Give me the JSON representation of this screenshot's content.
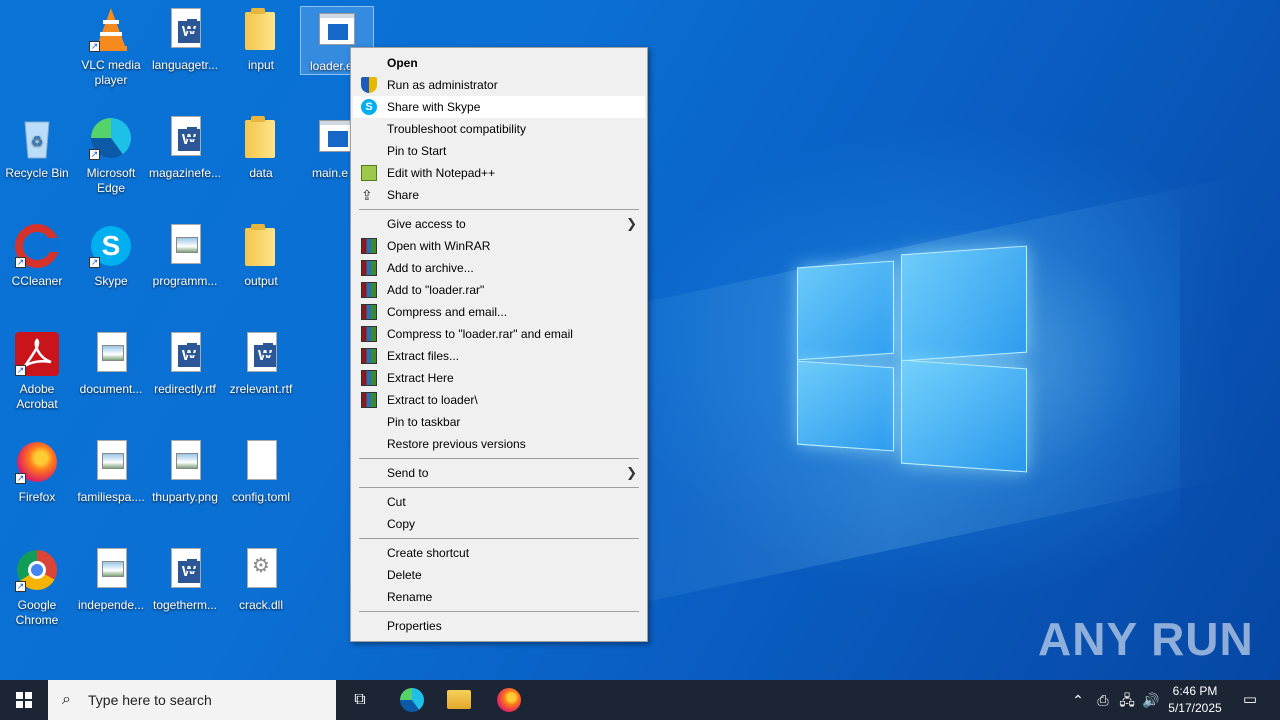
{
  "desktop": {
    "icons": [
      {
        "label": "VLC media player"
      },
      {
        "label": "languagetr..."
      },
      {
        "label": "input"
      },
      {
        "label": "loader.e"
      },
      {
        "label": "Recycle Bin"
      },
      {
        "label": "Microsoft Edge"
      },
      {
        "label": "magazinefe..."
      },
      {
        "label": "data"
      },
      {
        "label": "main.e"
      },
      {
        "label": "CCleaner"
      },
      {
        "label": "Skype"
      },
      {
        "label": "programm..."
      },
      {
        "label": "output"
      },
      {
        "label": "Adobe Acrobat"
      },
      {
        "label": "document..."
      },
      {
        "label": "redirectly.rtf"
      },
      {
        "label": "zrelevant.rtf"
      },
      {
        "label": "Firefox"
      },
      {
        "label": "familiespa...."
      },
      {
        "label": "thuparty.png"
      },
      {
        "label": "config.toml"
      },
      {
        "label": "Google Chrome"
      },
      {
        "label": "independe..."
      },
      {
        "label": "togetherm..."
      },
      {
        "label": "crack.dll"
      }
    ]
  },
  "context_menu": {
    "items": [
      {
        "label": "Open"
      },
      {
        "label": "Run as administrator"
      },
      {
        "label": "Share with Skype"
      },
      {
        "label": "Troubleshoot compatibility"
      },
      {
        "label": "Pin to Start"
      },
      {
        "label": "Edit with Notepad++"
      },
      {
        "label": "Share"
      },
      {
        "label": "Give access to"
      },
      {
        "label": "Open with WinRAR"
      },
      {
        "label": "Add to archive..."
      },
      {
        "label": "Add to \"loader.rar\""
      },
      {
        "label": "Compress and email..."
      },
      {
        "label": "Compress to \"loader.rar\" and email"
      },
      {
        "label": "Extract files..."
      },
      {
        "label": "Extract Here"
      },
      {
        "label": "Extract to loader\\"
      },
      {
        "label": "Pin to taskbar"
      },
      {
        "label": "Restore previous versions"
      },
      {
        "label": "Send to"
      },
      {
        "label": "Cut"
      },
      {
        "label": "Copy"
      },
      {
        "label": "Create shortcut"
      },
      {
        "label": "Delete"
      },
      {
        "label": "Rename"
      },
      {
        "label": "Properties"
      }
    ],
    "highlighted_item": "Share with Skype",
    "bold_item": "Open"
  },
  "taskbar": {
    "search_placeholder": "Type here to search",
    "clock_time": "6:46 PM",
    "clock_date": "5/17/2025",
    "apps": [
      "task-view-icon",
      "edge-icon",
      "file-explorer-icon",
      "firefox-icon"
    ]
  },
  "watermark": {
    "text": "ANY RUN"
  },
  "colors": {
    "desktop_blue": "#0a6fd3",
    "taskbar": "#1b2533",
    "menu_bg": "#f0f0f0",
    "menu_highlight": "#ffffff"
  }
}
